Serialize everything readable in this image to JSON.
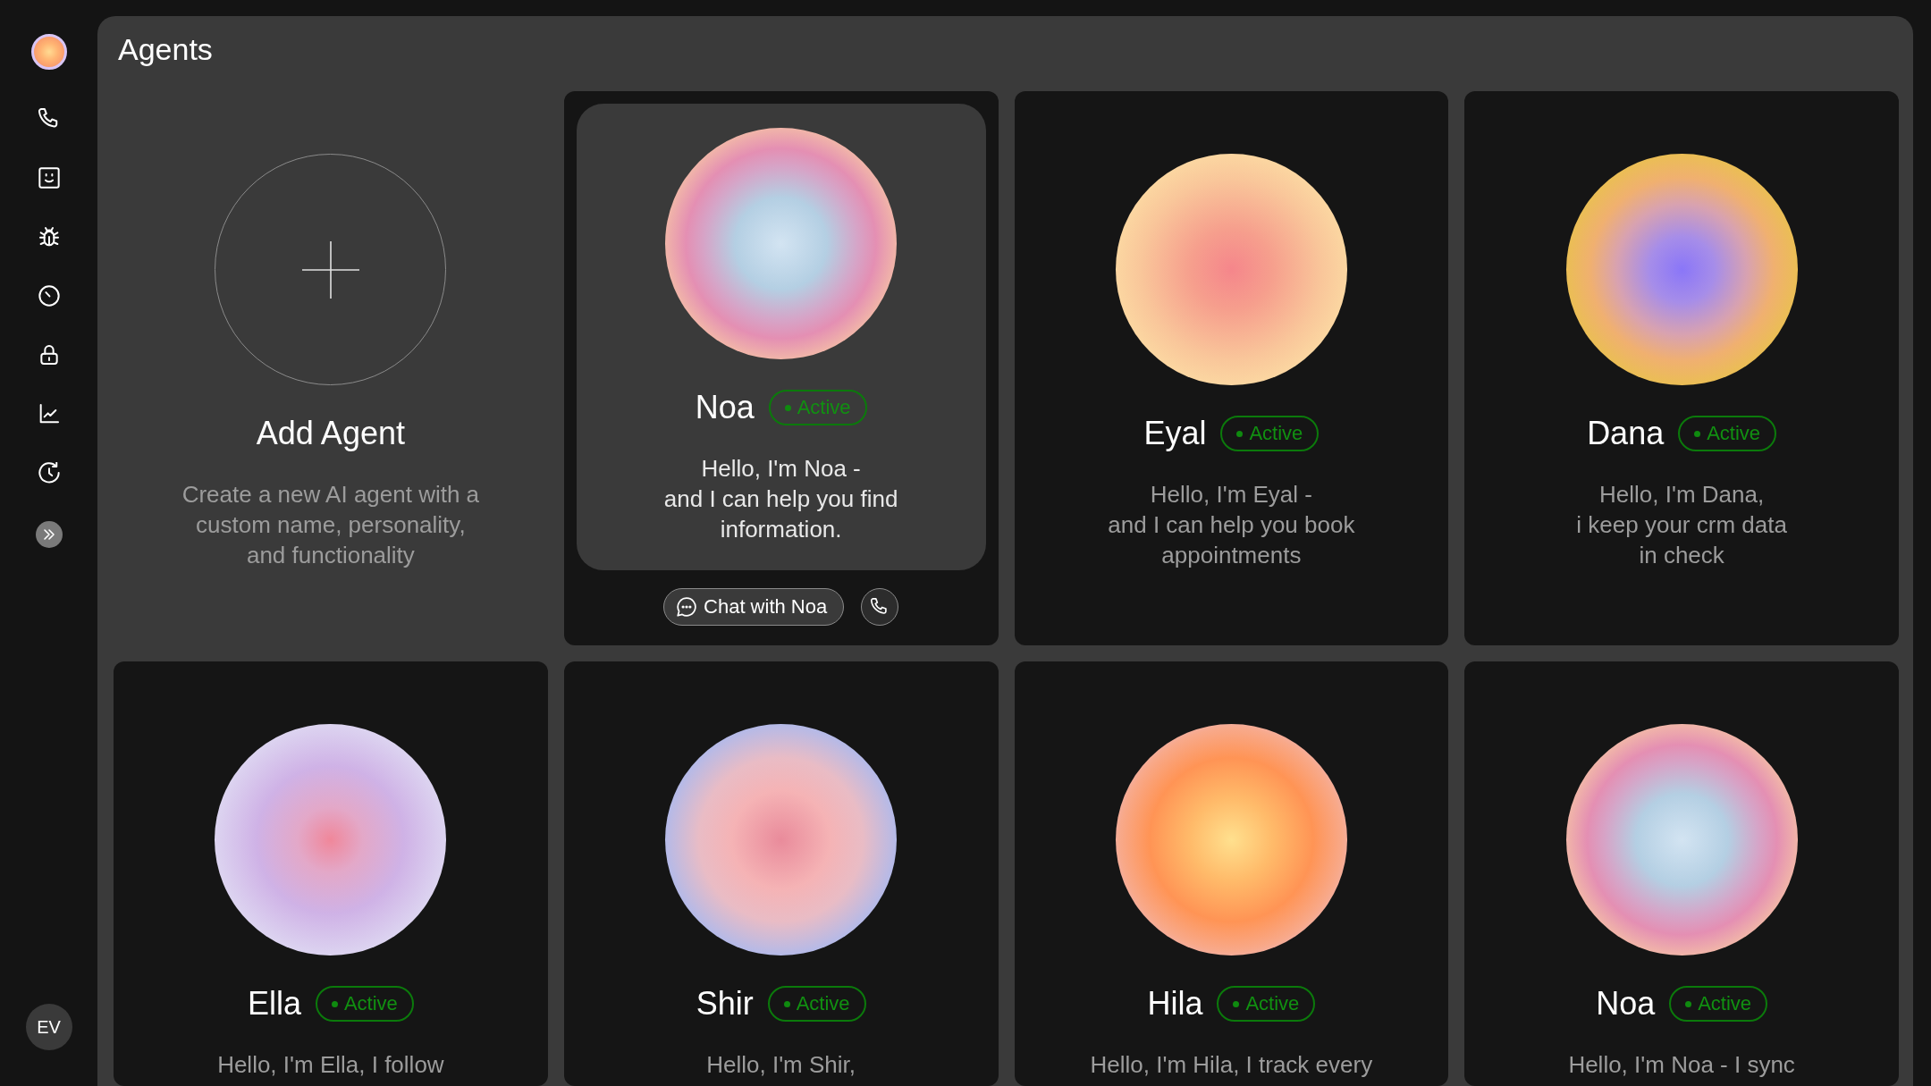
{
  "sidebar": {
    "user_initials": "EV"
  },
  "page": {
    "title": "Agents"
  },
  "add_agent": {
    "title": "Add Agent",
    "description": "Create a new AI agent with a\ncustom name, personality,\nand functionality"
  },
  "agents": [
    {
      "name": "Noa",
      "status": "Active",
      "description": "Hello, I'm Noa -\nand I can help you find\ninformation.",
      "selected": true,
      "chat_button": "Chat with Noa"
    },
    {
      "name": "Eyal",
      "status": "Active",
      "description": "Hello, I'm Eyal -\nand I can help you book\nappointments",
      "selected": false
    },
    {
      "name": "Dana",
      "status": "Active",
      "description": "Hello, I'm Dana,\ni keep your crm data\nin check",
      "selected": false
    },
    {
      "name": "Ella",
      "status": "Active",
      "description": "Hello, I'm Ella, I follow",
      "selected": false
    },
    {
      "name": "Shir",
      "status": "Active",
      "description": "Hello, I'm Shir,",
      "selected": false
    },
    {
      "name": "Hila",
      "status": "Active",
      "description": "Hello, I'm Hila, I track every",
      "selected": false
    },
    {
      "name": "Noa",
      "status": "Active",
      "description": "Hello, I'm Noa - I sync",
      "selected": false
    }
  ]
}
